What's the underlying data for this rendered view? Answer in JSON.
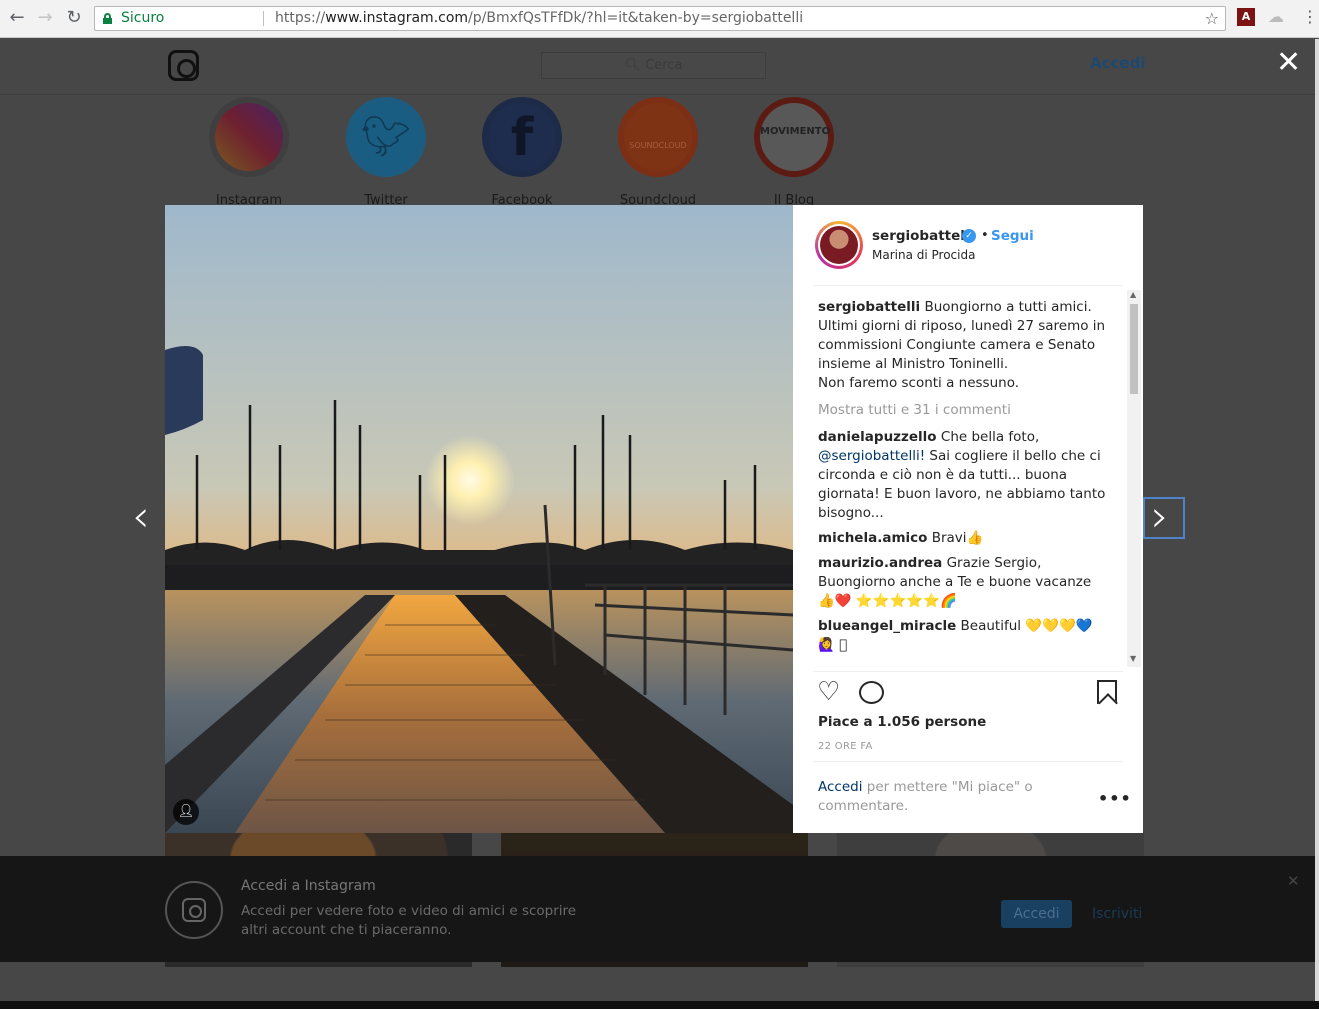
{
  "browser": {
    "secure_label": "Sicuro",
    "url_prefix": "https://",
    "url_host": "www.instagram.com",
    "url_path": "/p/BmxfQsTFfDk/?hl=it&taken-by=sergiobattelli"
  },
  "header": {
    "search_placeholder": "Cerca",
    "login": "Accedi"
  },
  "highlights": [
    {
      "label": "Instagram"
    },
    {
      "label": "Twitter"
    },
    {
      "label": "Facebook"
    },
    {
      "label": "Soundcloud",
      "inner_text": "SOUNDCLOUD"
    },
    {
      "label": "Il Blog",
      "inner_text": "MOVIMENTO"
    }
  ],
  "post": {
    "username": "sergiobattelli",
    "follow": "Segui",
    "dot": "•",
    "location": "Marina di Procida",
    "caption_user": "sergiobattelli",
    "caption": "Buongiorno a tutti amici. Ultimi giorni di riposo, lunedì 27 saremo in commissioni Congiunte camera e Senato insieme al Ministro Toninelli.",
    "caption_line2": "Non faremo sconti a nessuno.",
    "show_all": "Mostra tutti e 31 i commenti",
    "comments": [
      {
        "user": "danielapuzzello",
        "text_pre": "Che bella foto, ",
        "mention": "@sergiobattelli!",
        "text_post": " Sai cogliere il bello che ci circonda e ciò non è da tutti... buona giornata! E buon lavoro, ne abbiamo tanto bisogno..."
      },
      {
        "user": "michela.amico",
        "text_pre": "Bravi👍",
        "mention": "",
        "text_post": ""
      },
      {
        "user": "maurizio.andrea",
        "text_pre": "Grazie Sergio, Buongiorno anche a Te e buone vacanze 👍❤️ ⭐⭐⭐⭐⭐🌈",
        "mention": "",
        "text_post": ""
      },
      {
        "user": "blueangel_miracle",
        "text_pre": "Beautiful 💛💛💛💙 🙋‍♀️ 🏻",
        "mention": "",
        "text_post": ""
      }
    ],
    "likes": "Piace a 1.056 persone",
    "time": "22 ORE FA",
    "login_link": "Accedi",
    "login_note": " per mettere \"Mi piace\" o commentare.",
    "more": "•••"
  },
  "login_bar": {
    "title": "Accedi a Instagram",
    "text": "Accedi per vedere foto e video di amici e scoprire altri account che ti piaceranno.",
    "login_button": "Accedi",
    "signup": "Iscriviti",
    "close": "✕"
  },
  "icons": [
    "back-icon",
    "forward-icon",
    "reload-icon",
    "lock-icon",
    "star-icon",
    "pdf-icon",
    "menu-icon",
    "close-icon",
    "heart-icon",
    "comment-icon",
    "bookmark-icon",
    "chevron-left-icon",
    "chevron-right-icon",
    "user-tag-icon",
    "verified-icon"
  ],
  "colors": {
    "accent": "#3897f0",
    "link": "#003569",
    "secure": "#0b8043"
  }
}
